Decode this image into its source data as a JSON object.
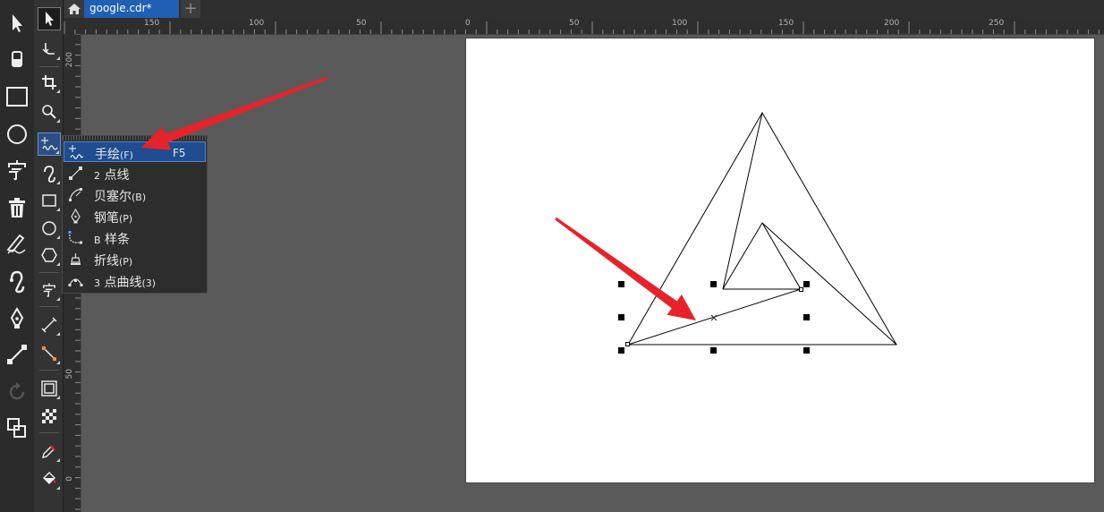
{
  "tabs": {
    "document_title": "google.cdr*",
    "add_label": "+"
  },
  "ruler": {
    "top_labels": [
      "150",
      "100",
      "50",
      "0",
      "50",
      "100",
      "150",
      "200",
      "250"
    ],
    "left_labels": [
      "200",
      "50",
      "0"
    ]
  },
  "flyout": {
    "items": [
      {
        "label": "手绘",
        "mnemonic": "(F)",
        "shortcut": "F5",
        "icon": "freehand-icon"
      },
      {
        "prefix": "2",
        "label": "点线",
        "icon": "2-point-line-icon"
      },
      {
        "label": "贝塞尔",
        "mnemonic": "(B)",
        "icon": "bezier-icon"
      },
      {
        "label": "钢笔",
        "mnemonic": "(P)",
        "icon": "pen-icon"
      },
      {
        "prefix": "B",
        "label": "样条",
        "icon": "b-spline-icon"
      },
      {
        "label": "折线",
        "mnemonic": "(P)",
        "icon": "polyline-icon"
      },
      {
        "prefix": "3",
        "label": "点曲线",
        "mnemonic": "(3)",
        "icon": "3-point-curve-icon"
      }
    ]
  },
  "colors": {
    "accent": "#1f5fb4",
    "annotation_arrow": "#e8222a",
    "toolbar": "#2b2b2b",
    "workspace": "#5a5a5a"
  }
}
